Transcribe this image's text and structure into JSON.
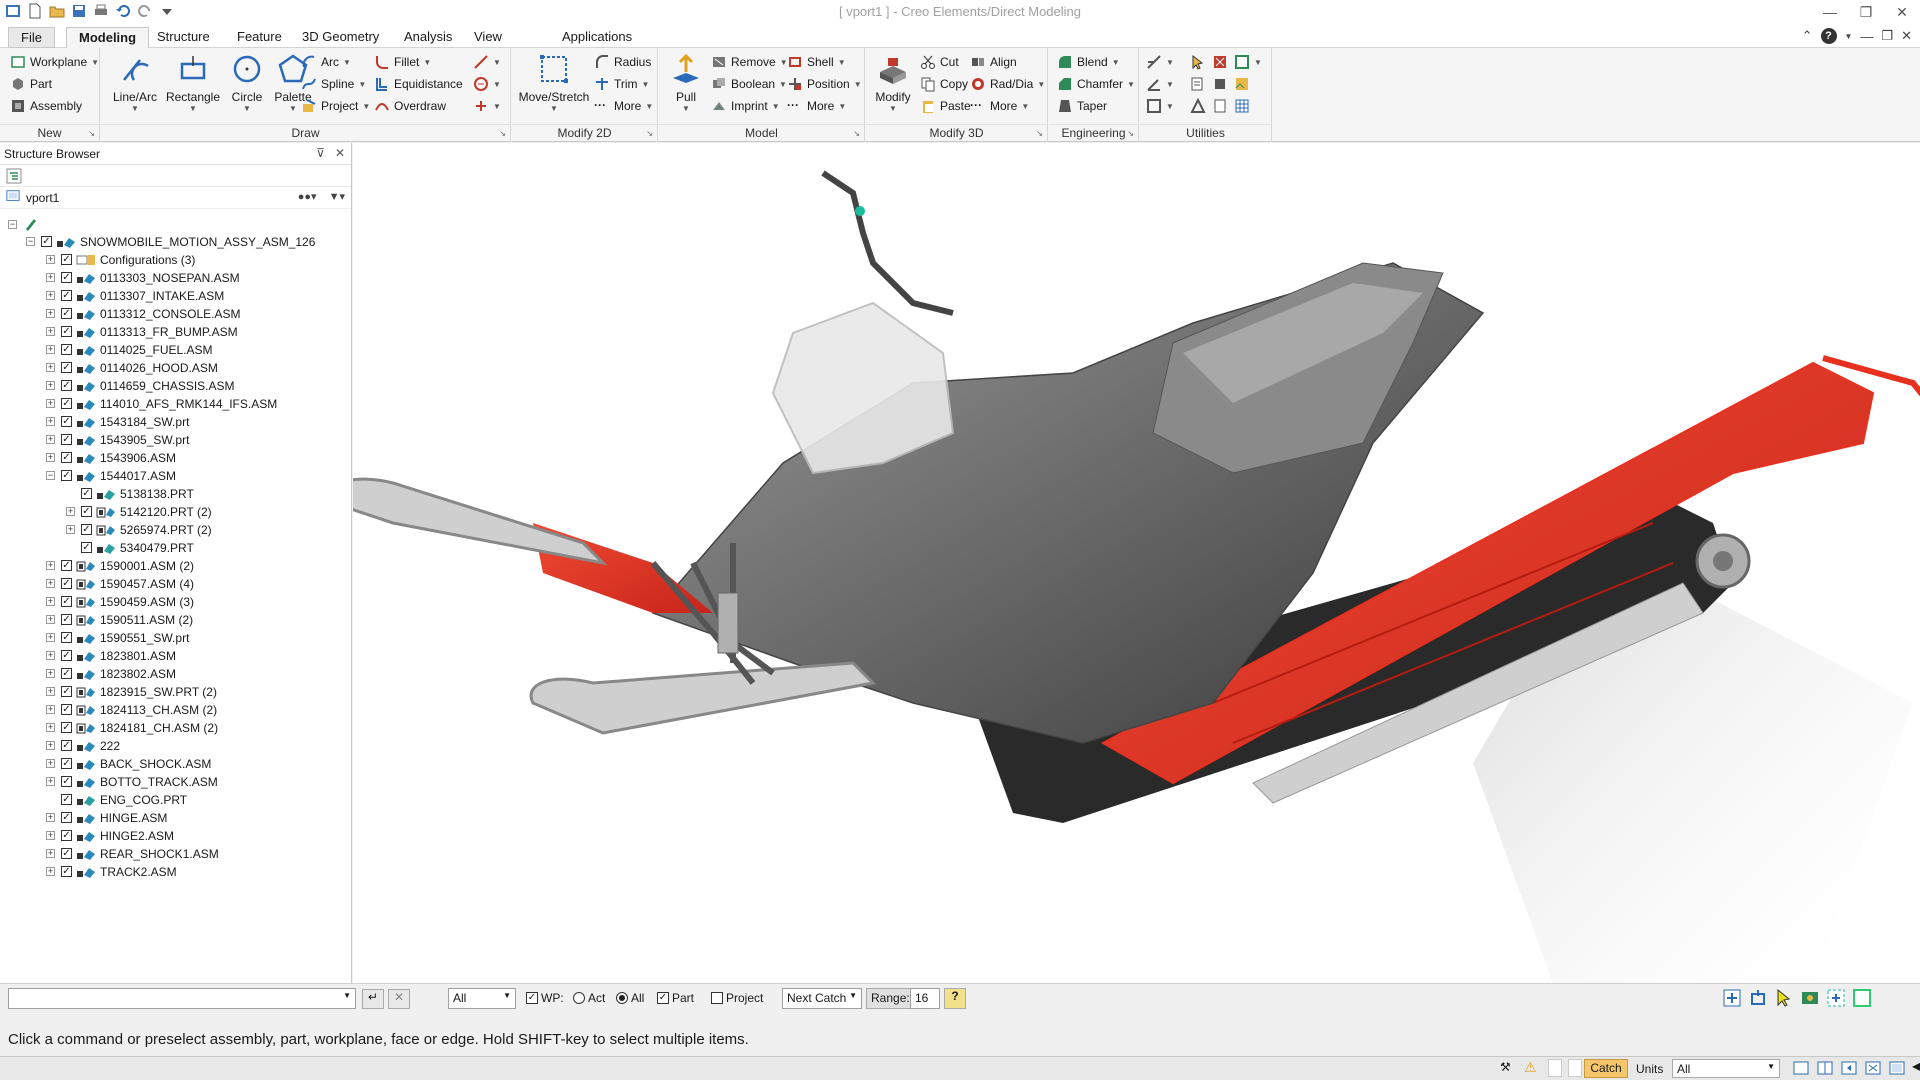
{
  "window": {
    "title": "[ vport1 ] - Creo Elements/Direct Modeling"
  },
  "tabs": [
    {
      "label": "File"
    },
    {
      "label": "Modeling"
    },
    {
      "label": "Structure"
    },
    {
      "label": "Feature"
    },
    {
      "label": "3D Geometry"
    },
    {
      "label": "Analysis"
    },
    {
      "label": "View"
    },
    {
      "label": "Applications"
    }
  ],
  "ribbon": {
    "new": {
      "label": "New",
      "items": [
        "Workplane",
        "Part",
        "Assembly"
      ]
    },
    "draw": {
      "label": "Draw",
      "big": [
        "Line/Arc",
        "Rectangle",
        "Circle",
        "Palette"
      ],
      "small": [
        "Arc",
        "Spline",
        "Project",
        "Fillet",
        "Equidistance",
        "Overdraw"
      ]
    },
    "modify2d": {
      "label": "Modify 2D",
      "big": "Move/Stretch",
      "small": [
        "Radius",
        "Trim",
        "More"
      ]
    },
    "model": {
      "label": "Model",
      "big": "Pull",
      "small": [
        "Remove",
        "Boolean",
        "Imprint",
        "Shell",
        "Position",
        "More"
      ]
    },
    "modify3d": {
      "label": "Modify 3D",
      "big": "Modify",
      "small": [
        "Cut",
        "Copy",
        "Paste",
        "Align",
        "Rad/Dia",
        "More"
      ]
    },
    "engineering": {
      "label": "Engineering",
      "small": [
        "Blend",
        "Chamfer",
        "Taper"
      ]
    },
    "utilities": {
      "label": "Utilities"
    }
  },
  "browser": {
    "title": "Structure Browser",
    "viewport": "vport1",
    "tree": [
      {
        "label": "SNOWMOBILE_MOTION_ASSY_ASM_126",
        "level": 1,
        "exp": "-",
        "icon": "asm"
      },
      {
        "label": "Configurations (3)",
        "level": 2,
        "exp": "+",
        "icon": "config"
      },
      {
        "label": "0113303_NOSEPAN.ASM",
        "level": 2,
        "exp": "+",
        "icon": "asm"
      },
      {
        "label": "0113307_INTAKE.ASM",
        "level": 2,
        "exp": "+",
        "icon": "asm"
      },
      {
        "label": "0113312_CONSOLE.ASM",
        "level": 2,
        "exp": "+",
        "icon": "asm"
      },
      {
        "label": "0113313_FR_BUMP.ASM",
        "level": 2,
        "exp": "+",
        "icon": "asm"
      },
      {
        "label": "0114025_FUEL.ASM",
        "level": 2,
        "exp": "+",
        "icon": "asm"
      },
      {
        "label": "0114026_HOOD.ASM",
        "level": 2,
        "exp": "+",
        "icon": "asm"
      },
      {
        "label": "0114659_CHASSIS.ASM",
        "level": 2,
        "exp": "+",
        "icon": "asm"
      },
      {
        "label": "114010_AFS_RMK144_IFS.ASM",
        "level": 2,
        "exp": "+",
        "icon": "asm"
      },
      {
        "label": "1543184_SW.prt",
        "level": 2,
        "exp": "+",
        "icon": "asm"
      },
      {
        "label": "1543905_SW.prt",
        "level": 2,
        "exp": "+",
        "icon": "asm"
      },
      {
        "label": "1543906.ASM",
        "level": 2,
        "exp": "+",
        "icon": "asm"
      },
      {
        "label": "1544017.ASM",
        "level": 2,
        "exp": "-",
        "icon": "asm"
      },
      {
        "label": "5138138.PRT",
        "level": 3,
        "exp": "",
        "icon": "part"
      },
      {
        "label": "5142120.PRT (2)",
        "level": 3,
        "exp": "+",
        "icon": "multi"
      },
      {
        "label": "5265974.PRT (2)",
        "level": 3,
        "exp": "+",
        "icon": "multi"
      },
      {
        "label": "5340479.PRT",
        "level": 3,
        "exp": "",
        "icon": "part"
      },
      {
        "label": "1590001.ASM (2)",
        "level": 2,
        "exp": "+",
        "icon": "multi"
      },
      {
        "label": "1590457.ASM (4)",
        "level": 2,
        "exp": "+",
        "icon": "multi"
      },
      {
        "label": "1590459.ASM (3)",
        "level": 2,
        "exp": "+",
        "icon": "multi"
      },
      {
        "label": "1590511.ASM (2)",
        "level": 2,
        "exp": "+",
        "icon": "multi"
      },
      {
        "label": "1590551_SW.prt",
        "level": 2,
        "exp": "+",
        "icon": "asm"
      },
      {
        "label": "1823801.ASM",
        "level": 2,
        "exp": "+",
        "icon": "asm"
      },
      {
        "label": "1823802.ASM",
        "level": 2,
        "exp": "+",
        "icon": "asm"
      },
      {
        "label": "1823915_SW.PRT (2)",
        "level": 2,
        "exp": "+",
        "icon": "multi"
      },
      {
        "label": "1824113_CH.ASM (2)",
        "level": 2,
        "exp": "+",
        "icon": "multi"
      },
      {
        "label": "1824181_CH.ASM (2)",
        "level": 2,
        "exp": "+",
        "icon": "multi"
      },
      {
        "label": "222",
        "level": 2,
        "exp": "+",
        "icon": "asm"
      },
      {
        "label": "BACK_SHOCK.ASM",
        "level": 2,
        "exp": "+",
        "icon": "asm"
      },
      {
        "label": "BOTTO_TRACK.ASM",
        "level": 2,
        "exp": "+",
        "icon": "asm"
      },
      {
        "label": "ENG_COG.PRT",
        "level": 2,
        "exp": "",
        "icon": "part"
      },
      {
        "label": "HINGE.ASM",
        "level": 2,
        "exp": "+",
        "icon": "asm"
      },
      {
        "label": "HINGE2.ASM",
        "level": 2,
        "exp": "+",
        "icon": "asm"
      },
      {
        "label": "REAR_SHOCK1.ASM",
        "level": 2,
        "exp": "+",
        "icon": "asm"
      },
      {
        "label": "TRACK2.ASM",
        "level": 2,
        "exp": "+",
        "icon": "asm"
      }
    ]
  },
  "cmdbar": {
    "filter": "All",
    "wp": "WP:",
    "act": "Act",
    "all": "All",
    "part": "Part",
    "project": "Project",
    "next_catch": "Next Catch",
    "range_label": "Range:",
    "range_value": "16"
  },
  "prompt": "Click a command or preselect assembly, part, workplane, face or edge. Hold SHIFT-key to select multiple items.",
  "status": {
    "catch": "Catch",
    "units": "Units",
    "units_value": "All"
  },
  "colors": {
    "highlight": "#e8301f",
    "catch_bg": "#f5c66b"
  }
}
